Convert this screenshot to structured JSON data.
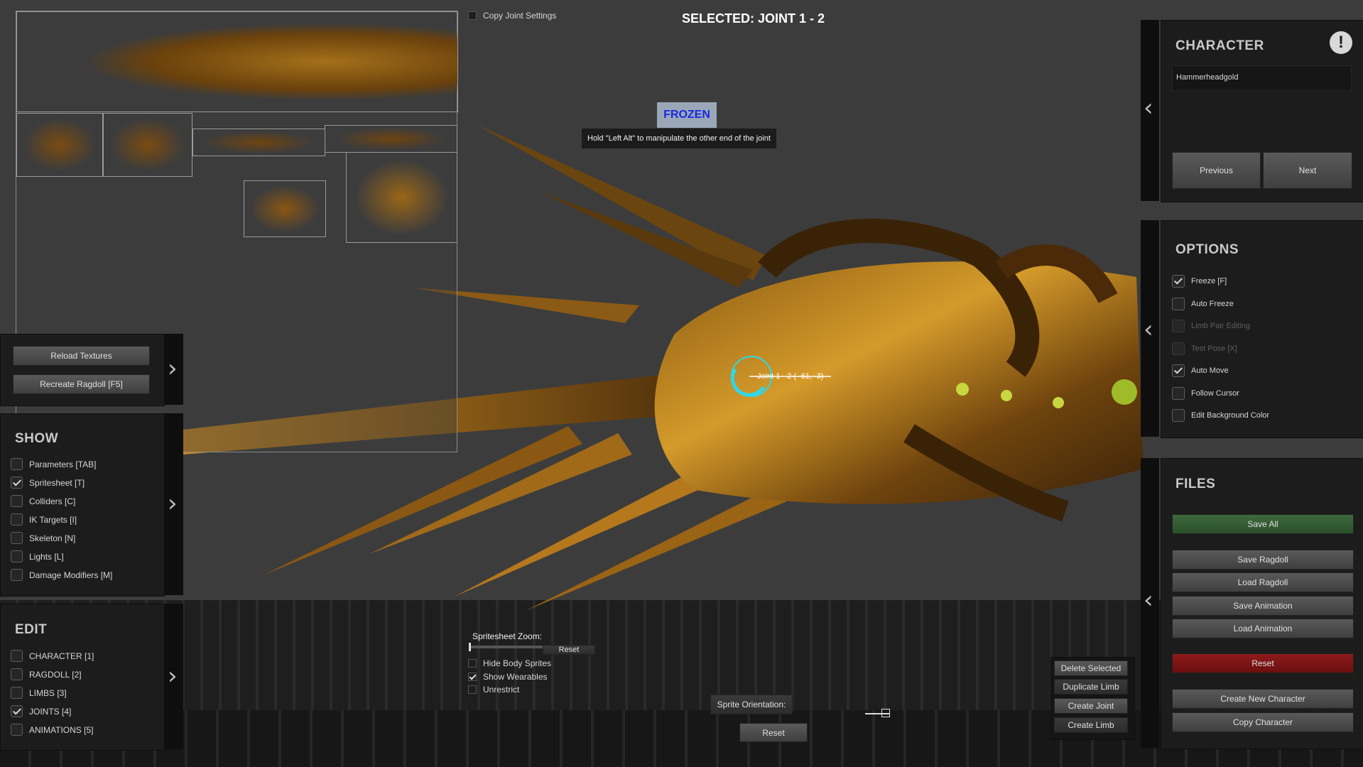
{
  "header": {
    "selected_title": "SELECTED: JOINT 1 - 2",
    "copy_joint_settings": "Copy Joint Settings"
  },
  "status": {
    "frozen_badge": "FROZEN",
    "tooltip": "Hold \"Left Alt\" to manipulate the other end of the joint",
    "joint_label": "Joint 1 - 2 ( -61, -3)"
  },
  "texture_panel": {
    "reload": "Reload Textures",
    "recreate": "Recreate Ragdoll [F5]"
  },
  "show_panel": {
    "title": "SHOW",
    "items": [
      {
        "label": "Parameters [TAB]",
        "checked": false
      },
      {
        "label": "Spritesheet [T]",
        "checked": true
      },
      {
        "label": "Colliders [C]",
        "checked": false
      },
      {
        "label": "IK Targets [I]",
        "checked": false
      },
      {
        "label": "Skeleton [N]",
        "checked": false
      },
      {
        "label": "Lights [L]",
        "checked": false
      },
      {
        "label": "Damage Modifiers [M]",
        "checked": false
      }
    ]
  },
  "edit_panel": {
    "title": "EDIT",
    "items": [
      {
        "label": "CHARACTER [1]",
        "checked": false
      },
      {
        "label": "RAGDOLL [2]",
        "checked": false
      },
      {
        "label": "LIMBS [3]",
        "checked": false
      },
      {
        "label": "JOINTS [4]",
        "checked": true
      },
      {
        "label": "ANIMATIONS [5]",
        "checked": false
      }
    ]
  },
  "character_panel": {
    "title": "CHARACTER",
    "name": "Hammerheadgold",
    "previous": "Previous",
    "next": "Next",
    "alert_icon": "!"
  },
  "options_panel": {
    "title": "OPTIONS",
    "items": [
      {
        "label": "Freeze [F]",
        "checked": true,
        "enabled": true
      },
      {
        "label": "Auto Freeze",
        "checked": false,
        "enabled": true
      },
      {
        "label": "Limb Pair Editing",
        "checked": false,
        "enabled": false
      },
      {
        "label": "Test Pose [X]",
        "checked": false,
        "enabled": false
      },
      {
        "label": "Auto Move",
        "checked": true,
        "enabled": true
      },
      {
        "label": "Follow Cursor",
        "checked": false,
        "enabled": true
      },
      {
        "label": "Edit Background Color",
        "checked": false,
        "enabled": true
      }
    ]
  },
  "files_panel": {
    "title": "FILES",
    "save_all": "Save All",
    "save_ragdoll": "Save Ragdoll",
    "load_ragdoll": "Load Ragdoll",
    "save_animation": "Save Animation",
    "load_animation": "Load Animation",
    "reset": "Reset",
    "create_new_character": "Create New Character",
    "copy_character": "Copy Character"
  },
  "bottom_controls": {
    "zoom_label": "Spritesheet Zoom:",
    "zoom_reset": "Reset",
    "hide_body_sprites": "Hide Body Sprites",
    "show_wearables": "Show Wearables",
    "unrestrict": "Unrestrict",
    "sprite_orientation": "Sprite Orientation:",
    "orientation_reset": "Reset"
  },
  "joint_actions": {
    "delete_selected": "Delete Selected",
    "duplicate_limb": "Duplicate Limb",
    "create_joint": "Create Joint",
    "create_limb": "Create Limb"
  },
  "colors": {
    "accent_green": "#2f5a2f",
    "accent_red": "#7d1414",
    "frozen_text": "#1a28e0",
    "joint_highlight": "#2fd8e8"
  }
}
